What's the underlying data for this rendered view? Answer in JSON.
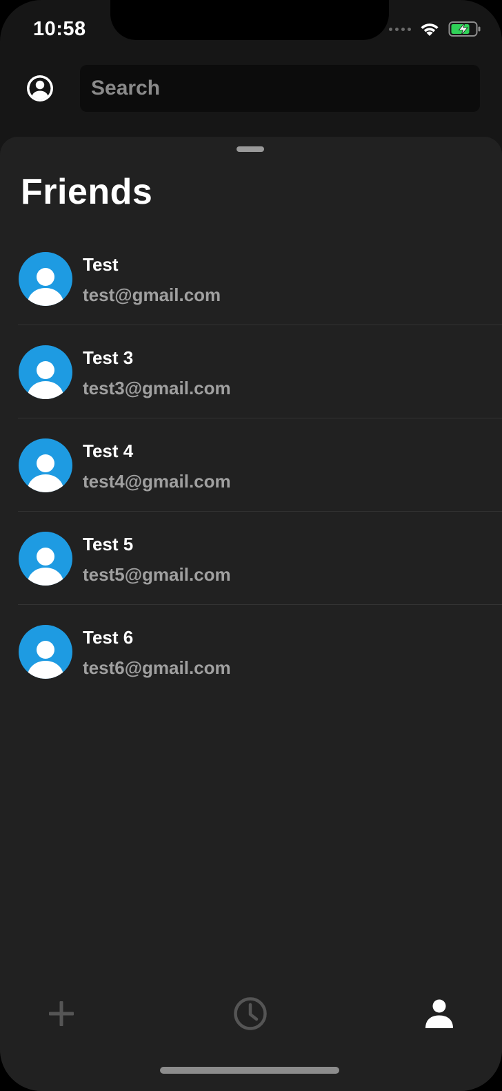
{
  "status_bar": {
    "time": "10:58",
    "battery_color": "#30d158"
  },
  "search": {
    "placeholder": "Search",
    "value": ""
  },
  "friends": {
    "title": "Friends",
    "items": [
      {
        "name": "Test",
        "email": "test@gmail.com"
      },
      {
        "name": "Test 3",
        "email": "test3@gmail.com"
      },
      {
        "name": "Test 4",
        "email": "test4@gmail.com"
      },
      {
        "name": "Test 5",
        "email": "test5@gmail.com"
      },
      {
        "name": "Test 6",
        "email": "test6@gmail.com"
      }
    ]
  },
  "tab_bar": {
    "tabs": [
      {
        "icon": "plus-icon",
        "active": false
      },
      {
        "icon": "clock-icon",
        "active": false
      },
      {
        "icon": "person-icon",
        "active": true
      }
    ]
  },
  "colors": {
    "avatar_bg": "#1e9be2",
    "sheet_bg": "#212121",
    "active_tab": "#ffffff",
    "inactive_tab": "#555555"
  }
}
